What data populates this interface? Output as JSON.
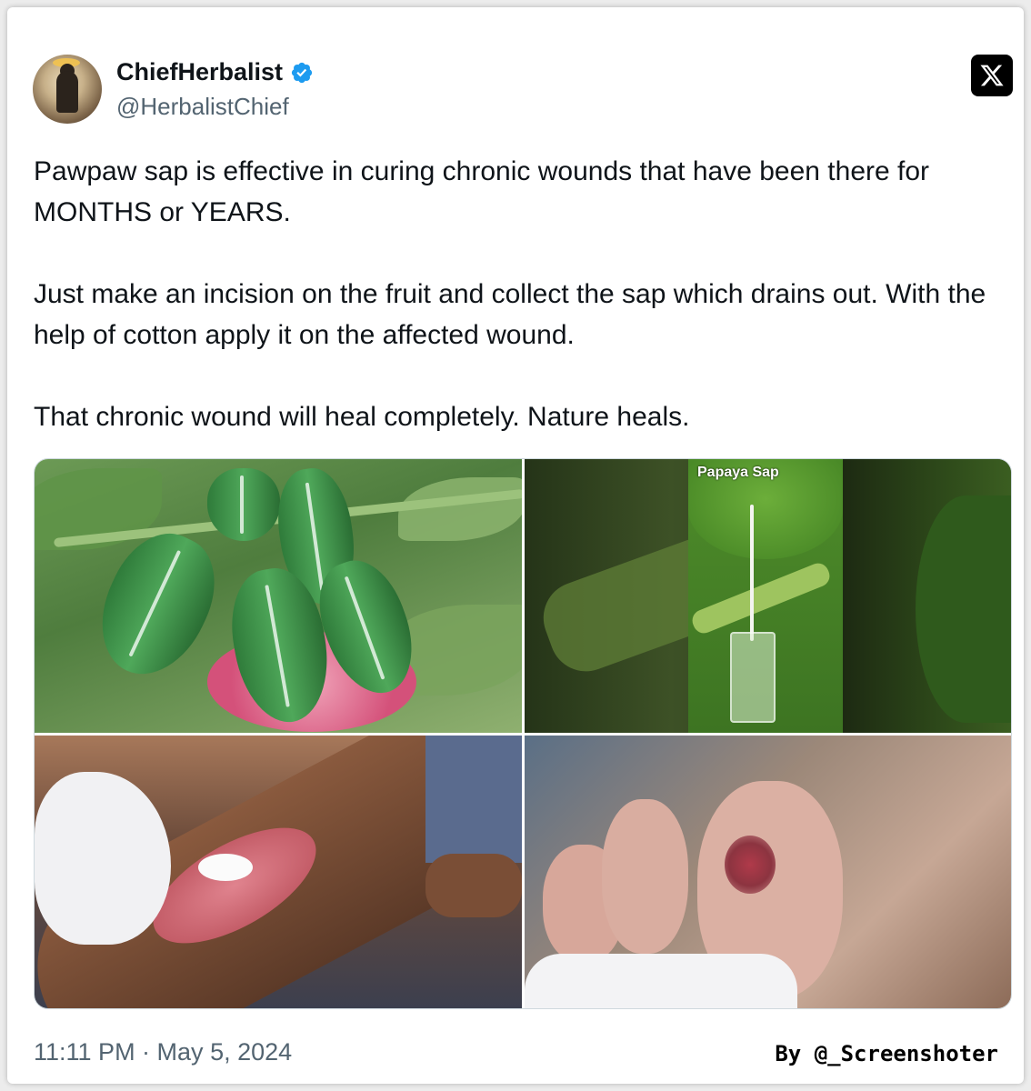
{
  "author": {
    "display_name": "ChiefHerbalist",
    "handle": "@HerbalistChief",
    "verified": true
  },
  "tweet": {
    "paragraphs": [
      "Pawpaw sap is effective in curing chronic wounds that have been there for MONTHS or YEARS.",
      "Just make an incision on the fruit and collect the sap which drains out. With the help of cotton apply it on the affected wound.",
      "That chronic wound will heal completely.  Nature heals."
    ],
    "timestamp": "11:11 PM · May 5, 2024"
  },
  "media": {
    "sap_label": "Papaya Sap"
  },
  "credit": "By @_Screenshoter",
  "colors": {
    "verified_blue": "#1d9bf0",
    "text_primary": "#0f1419",
    "text_secondary": "#536471"
  },
  "icons": [
    "verified-badge-icon",
    "x-logo-icon"
  ]
}
